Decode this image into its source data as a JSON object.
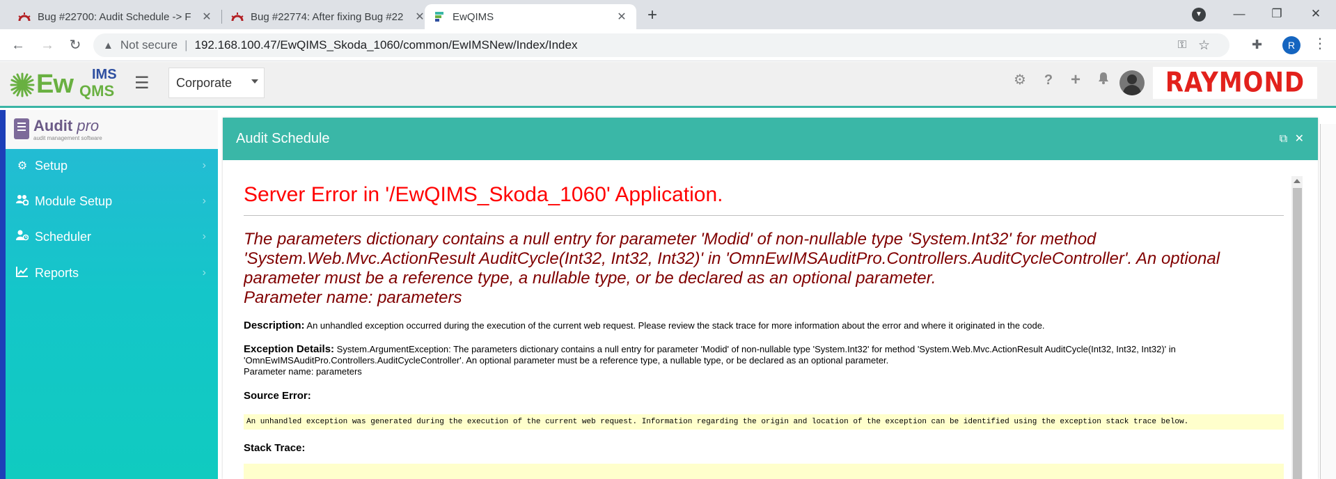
{
  "browser": {
    "tabs": [
      {
        "title": "Bug #22700: Audit Schedule -> F",
        "icon": "redmine-icon"
      },
      {
        "title": "Bug #22774: After fixing Bug #22",
        "icon": "redmine-icon"
      },
      {
        "title": "EwQIMS",
        "icon": "ewqims-favicon"
      }
    ],
    "security_label": "Not secure",
    "url": "192.168.100.47/EwQIMS_Skoda_1060/common/EwIMSNew/Index/Index",
    "profile_initial": "R"
  },
  "header": {
    "logo_ew": "Ew",
    "logo_ims": "IMS",
    "logo_qms": "QMS",
    "unit_select": "Corporate",
    "brand_logo": "RAYMOND",
    "accent_color": "#3ab7a7"
  },
  "sidebar": {
    "logo_main": "Audit",
    "logo_italic": "pro",
    "logo_tagline": "audit management software",
    "items": [
      {
        "label": "Setup",
        "icon": "gear-icon"
      },
      {
        "label": "Module Setup",
        "icon": "users-gear-icon"
      },
      {
        "label": "Scheduler",
        "icon": "user-clock-icon"
      },
      {
        "label": "Reports",
        "icon": "chart-icon"
      }
    ]
  },
  "panel": {
    "title": "Audit Schedule"
  },
  "error": {
    "title": "Server Error in '/EwQIMS_Skoda_1060' Application.",
    "message": "The parameters dictionary contains a null entry for parameter 'Modid' of non-nullable type 'System.Int32' for method 'System.Web.Mvc.ActionResult AuditCycle(Int32, Int32, Int32)' in 'OmnEwIMSAuditPro.Controllers.AuditCycleController'. An optional parameter must be a reference type, a nullable type, or be declared as an optional parameter.",
    "message_param": "Parameter name: parameters",
    "description_label": "Description:",
    "description": "An unhandled exception occurred during the execution of the current web request. Please review the stack trace for more information about the error and where it originated in the code.",
    "exception_label": "Exception Details:",
    "exception": "System.ArgumentException: The parameters dictionary contains a null entry for parameter 'Modid' of non-nullable type 'System.Int32' for method 'System.Web.Mvc.ActionResult AuditCycle(Int32, Int32, Int32)' in 'OmnEwIMSAuditPro.Controllers.AuditCycleController'. An optional parameter must be a reference type, a nullable type, or be declared as an optional parameter.",
    "exception_param": "Parameter name: parameters",
    "source_label": "Source Error:",
    "source_text": "An unhandled exception was generated during the execution of the current web request. Information regarding the origin and location of the exception can be identified using the exception stack trace below.",
    "stack_label": "Stack Trace:"
  }
}
